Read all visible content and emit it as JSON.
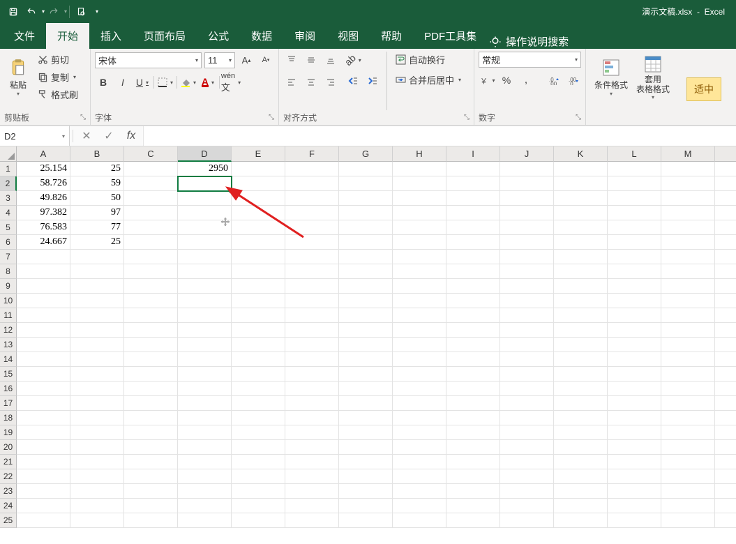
{
  "title": {
    "doc": "演示文稿.xlsx",
    "app": "Excel"
  },
  "qa": {
    "save": "保存",
    "undo": "撤消",
    "redo": "重做",
    "print": "打印预览"
  },
  "tabs": {
    "file": "文件",
    "home": "开始",
    "insert": "插入",
    "layout": "页面布局",
    "formula": "公式",
    "data": "数据",
    "review": "审阅",
    "view": "视图",
    "help": "帮助",
    "pdf": "PDF工具集",
    "search": "操作说明搜索"
  },
  "ribbon": {
    "clipboard": {
      "paste": "粘贴",
      "cut": "剪切",
      "copy": "复制",
      "painter": "格式刷",
      "label": "剪贴板"
    },
    "font": {
      "name": "宋体",
      "size": "11",
      "label": "字体",
      "bold": "B",
      "italic": "I",
      "underline": "U"
    },
    "align": {
      "wrap": "自动换行",
      "merge": "合并后居中",
      "label": "对齐方式"
    },
    "number": {
      "format": "常规",
      "label": "数字"
    },
    "styles": {
      "cond": "条件格式",
      "table": "套用\n表格格式",
      "fit": "适中"
    }
  },
  "fbar": {
    "name": "D2",
    "fx": "fx",
    "formula": ""
  },
  "sheet": {
    "cols": [
      "A",
      "B",
      "C",
      "D",
      "E",
      "F",
      "G",
      "H",
      "I",
      "J",
      "K",
      "L",
      "M"
    ],
    "rows": [
      1,
      2,
      3,
      4,
      5,
      6,
      7,
      8,
      9,
      10,
      11,
      12,
      13,
      14,
      15,
      16,
      17,
      18,
      19,
      20,
      21,
      22,
      23,
      24,
      25
    ],
    "active": {
      "col": 3,
      "row": 1
    },
    "data": {
      "A1": "25.154",
      "B1": "25",
      "D1": "2950",
      "A2": "58.726",
      "B2": "59",
      "A3": "49.826",
      "B3": "50",
      "A4": "97.382",
      "B4": "97",
      "A5": "76.583",
      "B5": "77",
      "A6": "24.667",
      "B6": "25"
    }
  }
}
